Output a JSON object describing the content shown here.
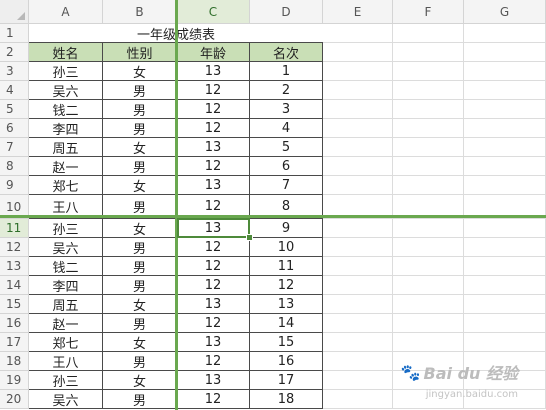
{
  "columns": [
    "A",
    "B",
    "C",
    "D",
    "E",
    "F",
    "G"
  ],
  "selected_column": "C",
  "selected_row": "11",
  "rows": [
    "1",
    "2",
    "3",
    "4",
    "5",
    "6",
    "7",
    "8",
    "9",
    "10",
    "11",
    "12",
    "13",
    "14",
    "15",
    "16",
    "17",
    "18",
    "19",
    "20"
  ],
  "table": {
    "title": "一年级成绩表",
    "headers": [
      "姓名",
      "性别",
      "年龄",
      "名次"
    ],
    "data": [
      [
        "孙三",
        "女",
        "13",
        "1"
      ],
      [
        "吴六",
        "男",
        "12",
        "2"
      ],
      [
        "钱二",
        "男",
        "12",
        "3"
      ],
      [
        "李四",
        "男",
        "12",
        "4"
      ],
      [
        "周五",
        "女",
        "13",
        "5"
      ],
      [
        "赵一",
        "男",
        "12",
        "6"
      ],
      [
        "郑七",
        "女",
        "13",
        "7"
      ],
      [
        "王八",
        "男",
        "12",
        "8"
      ],
      [
        "孙三",
        "女",
        "13",
        "9"
      ],
      [
        "吴六",
        "男",
        "12",
        "10"
      ],
      [
        "钱二",
        "男",
        "12",
        "11"
      ],
      [
        "李四",
        "男",
        "12",
        "12"
      ],
      [
        "周五",
        "女",
        "13",
        "13"
      ],
      [
        "赵一",
        "男",
        "12",
        "14"
      ],
      [
        "郑七",
        "女",
        "13",
        "15"
      ],
      [
        "王八",
        "男",
        "12",
        "16"
      ],
      [
        "孙三",
        "女",
        "13",
        "17"
      ],
      [
        "吴六",
        "男",
        "12",
        "18"
      ]
    ]
  },
  "watermark": {
    "text": "Bai du 经验",
    "sub": "jingyan.baidu.com",
    "icon": "paw-icon"
  },
  "colors": {
    "header_fill": "#c9dfb6",
    "freeze_line": "#6aa84f",
    "active_border": "#4e8a3a"
  }
}
